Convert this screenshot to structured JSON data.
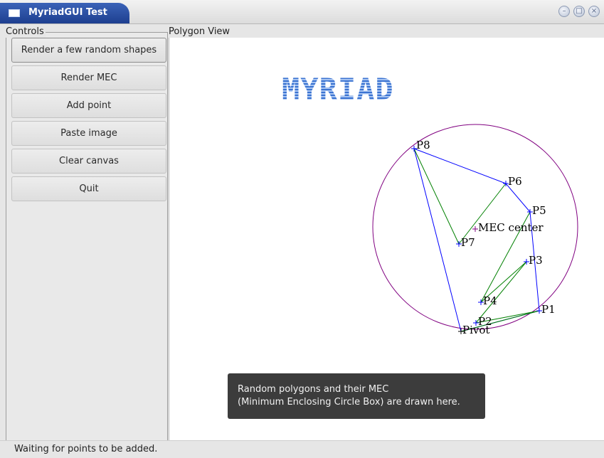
{
  "window": {
    "title": "MyriadGUI Test",
    "buttons": [
      "minimize-icon",
      "maximize-icon",
      "close-icon"
    ]
  },
  "controls": {
    "group_title": "Controls",
    "buttons": [
      "Render a few random shapes",
      "Render MEC",
      "Add point",
      "Paste image",
      "Clear canvas",
      "Quit"
    ]
  },
  "view": {
    "group_title": "Polygon View",
    "banner": "MYRIAD",
    "tooltip": [
      "Random polygons and their MEC",
      "(Minimum Enclosing Circle Box) are drawn here."
    ],
    "points": [
      {
        "label": "P8"
      },
      {
        "label": "P6"
      },
      {
        "label": "P5"
      },
      {
        "label": "MEC center"
      },
      {
        "label": "P7"
      },
      {
        "label": "P3"
      },
      {
        "label": "P4"
      },
      {
        "label": "P1"
      },
      {
        "label": "P2"
      },
      {
        "label": "Pivot"
      }
    ],
    "colors": {
      "hull": "#0000ff",
      "fan": "#008000",
      "circle": "#800080",
      "marker": "#0000ff"
    }
  },
  "status": {
    "text": "Waiting for points to be added."
  }
}
